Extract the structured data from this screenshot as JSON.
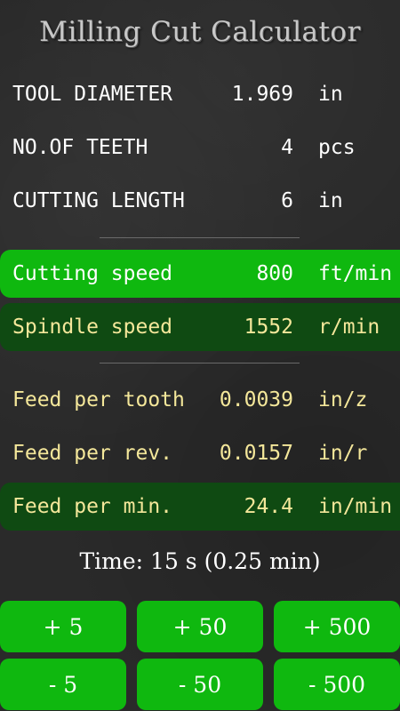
{
  "app": {
    "title": "Milling Cut Calculator"
  },
  "inputs": [
    {
      "label": "TOOL DIAMETER",
      "value": "1.969",
      "unit": "in"
    },
    {
      "label": "NO.OF TEETH",
      "value": "4",
      "unit": "pcs"
    },
    {
      "label": "CUTTING LENGTH",
      "value": "6",
      "unit": "in"
    }
  ],
  "speeds": [
    {
      "label": "Cutting speed",
      "value": "800",
      "unit": "ft/min"
    },
    {
      "label": "Spindle speed",
      "value": "1552",
      "unit": "r/min"
    }
  ],
  "feeds": [
    {
      "label": "Feed per tooth",
      "value": "0.0039",
      "unit": "in/z"
    },
    {
      "label": "Feed per rev.",
      "value": "0.0157",
      "unit": "in/r"
    },
    {
      "label": "Feed per min.",
      "value": "24.4",
      "unit": "in/min"
    }
  ],
  "time": {
    "text": "Time:  15 s  (0.25 min)"
  },
  "buttons": {
    "plus5": "+ 5",
    "plus50": "+ 50",
    "plus500": "+ 500",
    "minus5": "- 5",
    "minus50": "- 50",
    "minus500": "- 500"
  },
  "colors": {
    "accent_green": "#0fb80f",
    "dark_green": "#0f4a12",
    "label_yellow": "#f4e79a"
  }
}
